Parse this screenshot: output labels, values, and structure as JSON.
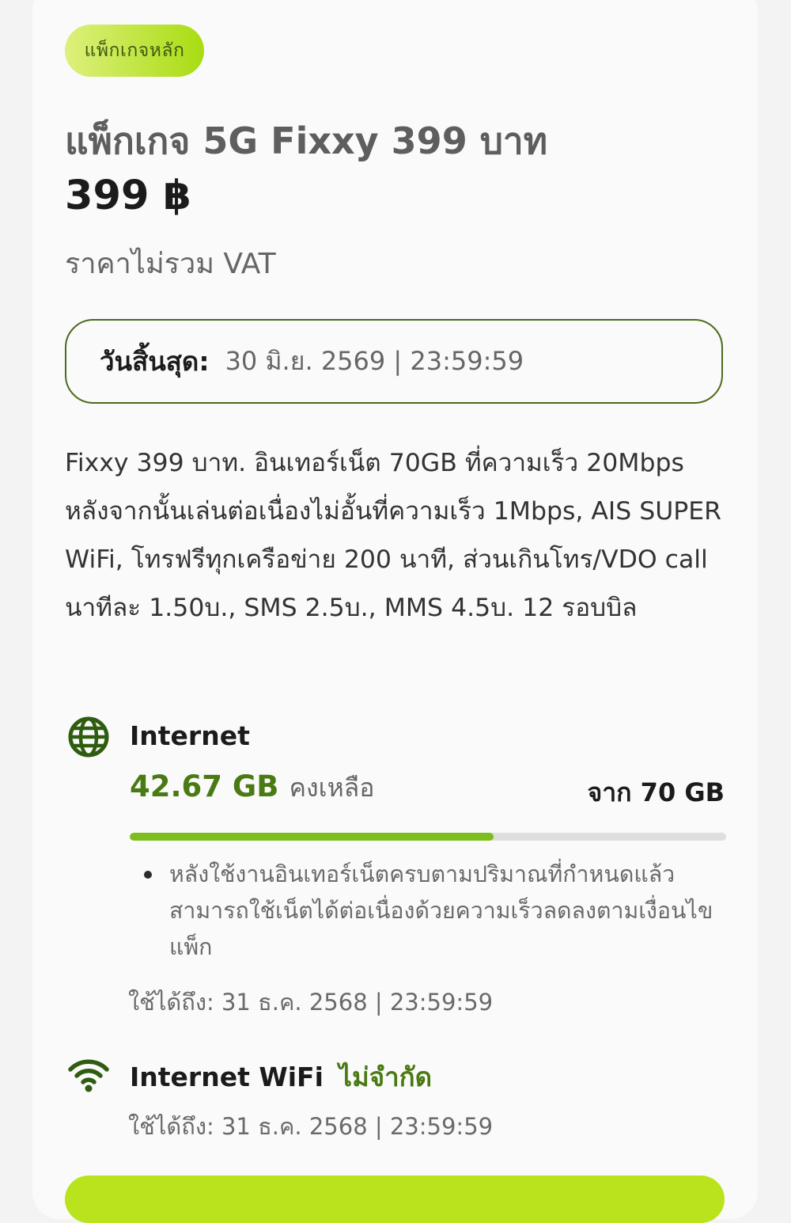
{
  "package": {
    "badge": "แพ็กเกจหลัก",
    "title": "แพ็กเกจ 5G Fixxy 399 บาท",
    "price": "399 ฿",
    "vat_note": "ราคาไม่รวม VAT",
    "expiry_label": "วันสิ้นสุด:",
    "expiry_value": "30 มิ.ย. 2569 | 23:59:59",
    "description": "Fixxy 399 บาท. อินเทอร์เน็ต 70GB ที่ความเร็ว 20Mbps หลังจากนั้นเล่นต่อเนื่องไม่อั้นที่ความเร็ว 1Mbps, AIS SUPER WiFi, โทรฟรีทุกเครือข่าย 200 นาที, ส่วนเกินโทร/VDO call นาทีละ 1.50บ., SMS 2.5บ., MMS 4.5บ. 12 รอบบิล"
  },
  "internet": {
    "icon": "globe-icon",
    "title": "Internet",
    "remaining_value": "42.67 GB",
    "remaining_label": "คงเหลือ",
    "total": "จาก 70 GB",
    "remaining_fraction": 0.6096,
    "note": "หลังใช้งานอินเทอร์เน็ตครบตามปริมาณที่กำหนดแล้ว สามารถใช้เน็ตได้ต่อเนื่องด้วยความเร็วลดลงตามเงื่อนไขแพ็ก",
    "valid_until": "ใช้ได้ถึง: 31 ธ.ค. 2568 | 23:59:59"
  },
  "wifi": {
    "icon": "wifi-icon",
    "title": "Internet WiFi",
    "unlimited": "ไม่จำกัด",
    "valid_until": "ใช้ได้ถึง: 31 ธ.ค. 2568 | 23:59:59"
  },
  "colors": {
    "accent_green": "#4a7a13",
    "progress_fill": "#7cbe1c",
    "badge_gradient_start": "#ddf07c",
    "badge_gradient_end": "#a9dc12"
  }
}
